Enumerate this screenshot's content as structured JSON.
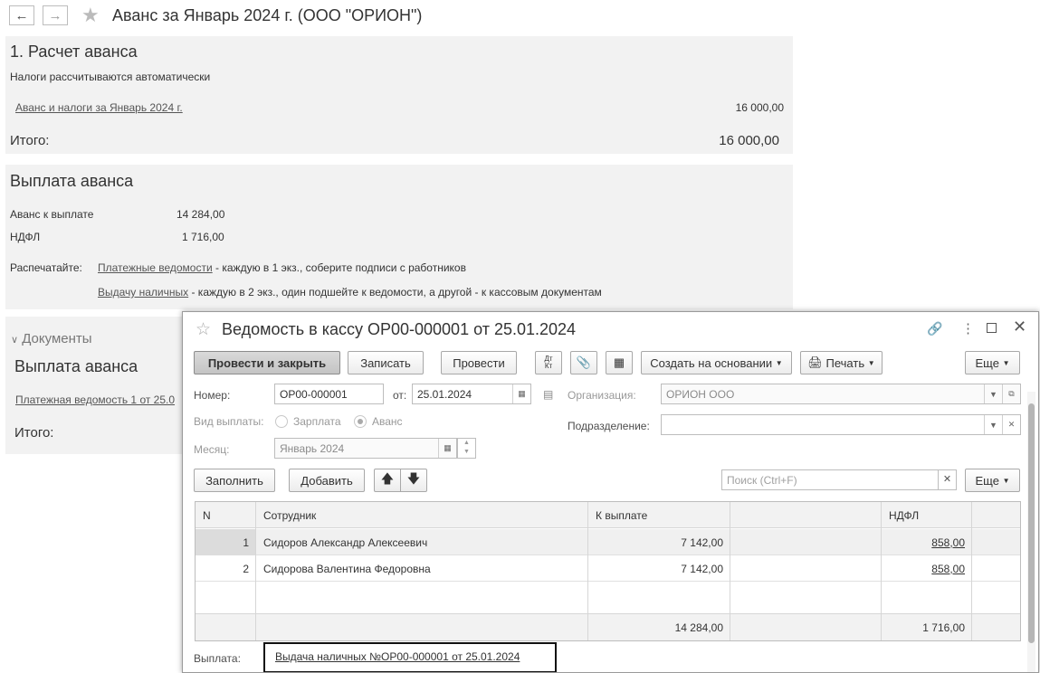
{
  "main": {
    "title": "Аванс за Январь 2024 г. (ООО \"ОРИОН\")",
    "section1_title": "1. Расчет аванса",
    "auto_taxes": "Налоги рассчитываются автоматически",
    "advance_link": "Аванс и налоги за Январь 2024 г.",
    "advance_amount": "16 000,00",
    "total_label": "Итого:",
    "total_value": "16 000,00",
    "payout_title": "Выплата аванса",
    "payout_label": "Аванс к выплате",
    "payout_value": "14 284,00",
    "ndfl_label": "НДФЛ",
    "ndfl_value": "1 716,00",
    "print_label": "Распечатайте:",
    "print_link1": "Платежные ведомости",
    "print_text1": " - каждую в 1 экз., соберите подписи с работников",
    "print_link2": "Выдачу наличных",
    "print_text2": " - каждую в 2 экз., один подшейте к ведомости, а другой - к кассовым документам",
    "docs_label": "Документы",
    "docs_title": "Выплата аванса",
    "docs_link": "Платежная ведомость 1 от 25.0",
    "docs_total_label": "Итого:"
  },
  "dialog": {
    "title": "Ведомость в кассу ОР00-000001 от 25.01.2024",
    "toolbar": {
      "post_close": "Провести и закрыть",
      "save": "Записать",
      "post": "Провести",
      "dtkt": "Дт Кт",
      "create_based": "Создать на основании",
      "print": "Печать",
      "more": "Еще"
    },
    "number_label": "Номер:",
    "number_value": "ОР00-000001",
    "date_label": "от:",
    "date_value": "25.01.2024",
    "org_label": "Организация:",
    "org_value": "ОРИОН ООО",
    "pay_type_label": "Вид выплаты:",
    "pay_type_opt1": "Зарплата",
    "pay_type_opt2": "Аванс",
    "dept_label": "Подразделение:",
    "dept_value": "",
    "month_label": "Месяц:",
    "month_value": "Январь 2024",
    "fill_btn": "Заполнить",
    "add_btn": "Добавить",
    "search_placeholder": "Поиск (Ctrl+F)",
    "more2": "Еще",
    "table": {
      "headers": [
        "N",
        "Сотрудник",
        "К выплате",
        "НДФЛ"
      ],
      "rows": [
        {
          "n": "1",
          "employee": "Сидоров Александр Алексеевич",
          "pay": "7 142,00",
          "ndfl": "858,00"
        },
        {
          "n": "2",
          "employee": "Сидорова Валентина Федоровна",
          "pay": "7 142,00",
          "ndfl": "858,00"
        }
      ],
      "footer_pay": "14 284,00",
      "footer_ndfl": "1 716,00"
    },
    "payment_label": "Выплата:",
    "payment_link": "Выдача наличных №ОР00-000001 от 25.01.2024"
  }
}
